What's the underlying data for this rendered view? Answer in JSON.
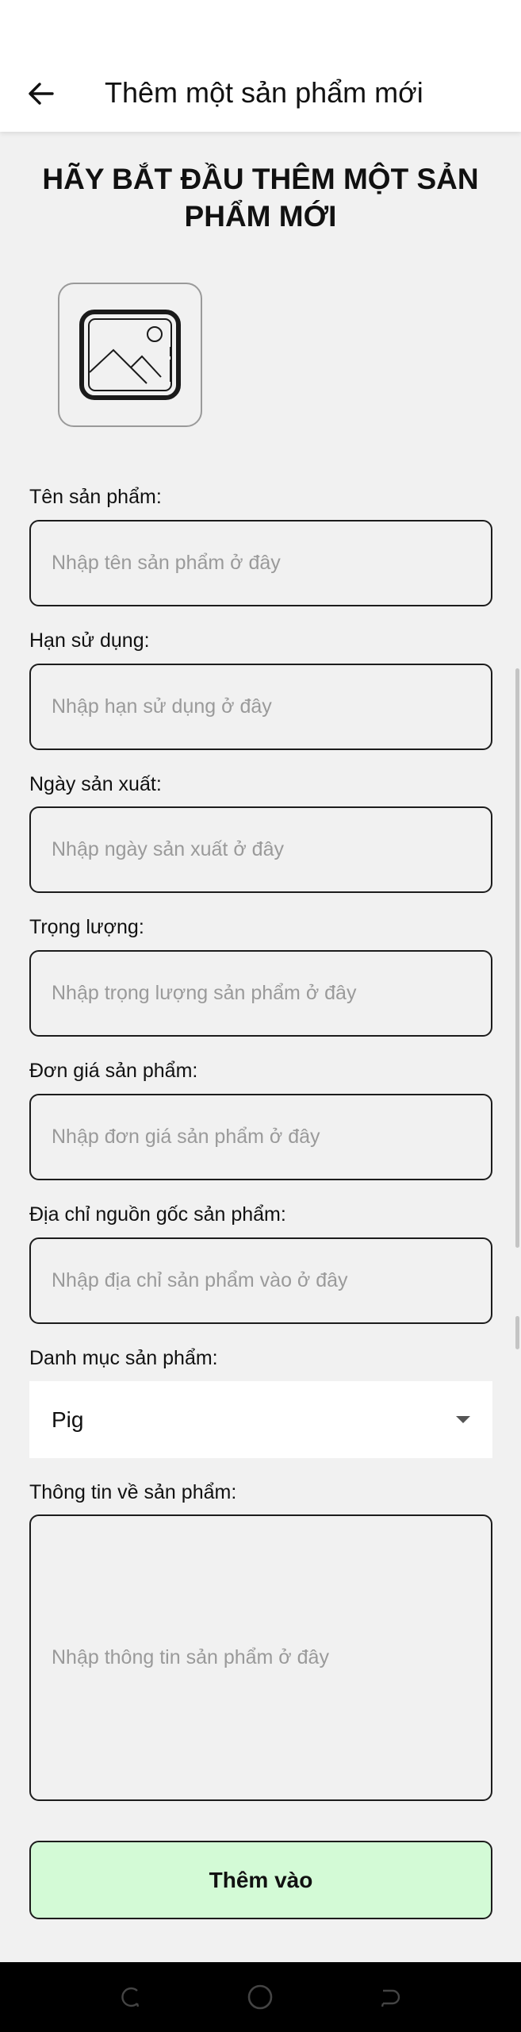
{
  "app_bar": {
    "title": "Thêm một sản phẩm mới",
    "back_icon": "arrow-left-icon"
  },
  "heading": "HÃY BẮT ĐẦU THÊM MỘT SẢN PHẨM MỚI",
  "image_picker": {
    "icon": "image-placeholder-icon"
  },
  "fields": [
    {
      "label": "Tên sản phẩm:",
      "placeholder": "Nhập tên sản phẩm ở đây"
    },
    {
      "label": "Hạn sử dụng:",
      "placeholder": "Nhập hạn sử dụng ở đây"
    },
    {
      "label": "Ngày sản xuất:",
      "placeholder": "Nhập ngày sản xuất ở đây"
    },
    {
      "label": "Trọng lượng:",
      "placeholder": "Nhập trọng lượng sản phẩm ở đây"
    },
    {
      "label": "Đơn giá sản phẩm:",
      "placeholder": "Nhập đơn giá sản phẩm ở đây"
    },
    {
      "label": "Địa chỉ nguồn gốc sản phẩm:",
      "placeholder": "Nhập địa chỉ sản phẩm vào ở đây"
    }
  ],
  "category": {
    "label": "Danh mục sản phẩm:",
    "selected": "Pig",
    "icon": "caret-down-icon"
  },
  "description": {
    "label": "Thông tin về sản phẩm:",
    "placeholder": "Nhập thông tin sản phẩm ở đây"
  },
  "submit_label": "Thêm vào",
  "colors": {
    "background": "#f1f1f1",
    "app_bar": "#ffffff",
    "submit_button": "#d3fad6",
    "border": "#1c1c1c",
    "placeholder": "#9a9a9a"
  },
  "nav_bar": {
    "icons": [
      "recent-apps-icon",
      "home-icon",
      "back-nav-icon"
    ]
  }
}
